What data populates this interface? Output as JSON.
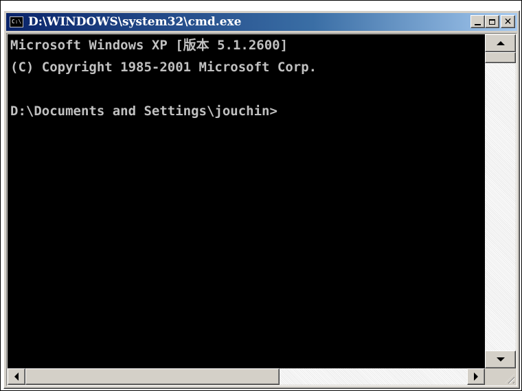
{
  "window": {
    "title": "D:\\WINDOWS\\system32\\cmd.exe",
    "icon_name": "cmd-console-icon",
    "icon_text": "C:\\",
    "titlebar_colors": {
      "start": "#0a246a",
      "end": "#a6caf0"
    }
  },
  "title_buttons": {
    "minimize_icon": "minimize-icon",
    "maximize_icon": "maximize-icon",
    "close_icon": "close-icon",
    "close_glyph": "✕"
  },
  "console": {
    "background": "#000000",
    "foreground": "#c0c0c0",
    "lines": [
      "Microsoft Windows XP [版本 5.1.2600]",
      "(C) Copyright 1985-2001 Microsoft Corp.",
      "",
      "D:\\Documents and Settings\\jouchin>"
    ]
  },
  "scrollbars": {
    "vertical": {
      "up_icon": "scroll-up-arrow-icon",
      "down_icon": "scroll-down-arrow-icon",
      "position": 0
    },
    "horizontal": {
      "left_icon": "scroll-left-arrow-icon",
      "right_icon": "scroll-right-arrow-icon",
      "position": 0
    },
    "grip_icon": "resize-grip-icon"
  }
}
